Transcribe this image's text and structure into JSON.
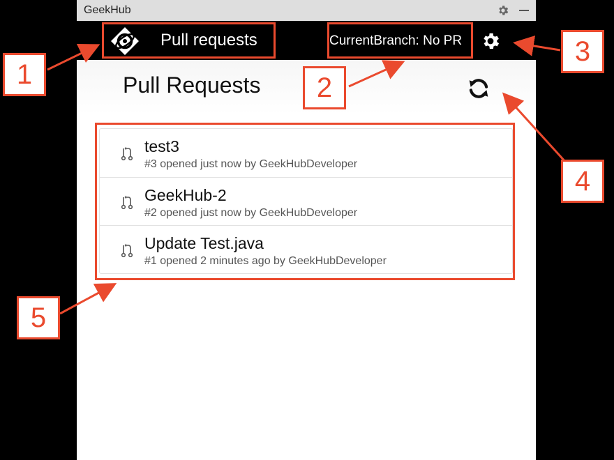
{
  "window": {
    "title": "GeekHub",
    "icons": [
      "gear-icon",
      "minimize-icon"
    ]
  },
  "appbar": {
    "title": "Pull requests",
    "current_branch": "CurrentBranch: No PR",
    "icons": [
      "geekhub-logo",
      "settings-gear-icon"
    ]
  },
  "main": {
    "heading": "Pull Requests",
    "refresh_icon": "refresh-icon",
    "pull_requests": [
      {
        "title": "test3",
        "meta": "#3 opened just now by GeekHubDeveloper"
      },
      {
        "title": "GeekHub-2",
        "meta": "#2 opened just now by GeekHubDeveloper"
      },
      {
        "title": "Update Test.java",
        "meta": "#1 opened 2 minutes ago by GeekHubDeveloper"
      }
    ]
  },
  "annotations": {
    "labels": [
      "1",
      "2",
      "3",
      "4",
      "5"
    ],
    "color": "#ea4a2e"
  },
  "colors": {
    "appbar": "#000000",
    "titlebar": "#dedede",
    "accent": "#ea4a2e"
  }
}
